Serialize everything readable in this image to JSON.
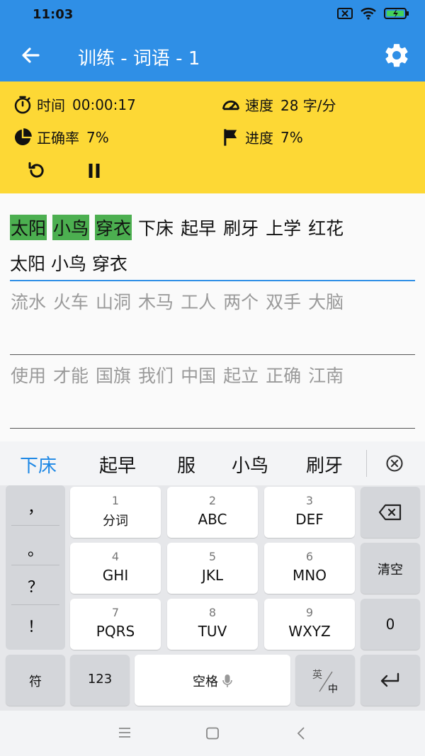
{
  "status": {
    "time": "11:03"
  },
  "appbar": {
    "title": "训练 - 词语 - 1"
  },
  "stats": {
    "time_label": "时间",
    "time_value": "00:00:17",
    "speed_label": "速度",
    "speed_value": "28 字/分",
    "accuracy_label": "正确率",
    "accuracy_value": "7%",
    "progress_label": "进度",
    "progress_value": "7%"
  },
  "practice": {
    "line1_words": [
      "太阳",
      "小鸟",
      "穿衣",
      "下床",
      "起早",
      "刷牙",
      "上学",
      "红花"
    ],
    "line1_done_count": 3,
    "typed_line": "太阳 小鸟 穿衣",
    "line2_words": [
      "流水",
      "火车",
      "山洞",
      "木马",
      "工人",
      "两个",
      "双手",
      "大脑"
    ],
    "line3_words": [
      "使用",
      "才能",
      "国旗",
      "我们",
      "中国",
      "起立",
      "正确",
      "江南"
    ]
  },
  "candidates": [
    "下床",
    "起早",
    "服",
    "小鸟",
    "刷牙"
  ],
  "keyboard": {
    "punct": [
      "，",
      "。",
      "？",
      "！"
    ],
    "keys": [
      {
        "num": "1",
        "label": "分词"
      },
      {
        "num": "2",
        "label": "ABC"
      },
      {
        "num": "3",
        "label": "DEF"
      },
      {
        "num": "4",
        "label": "GHI"
      },
      {
        "num": "5",
        "label": "JKL"
      },
      {
        "num": "6",
        "label": "MNO"
      },
      {
        "num": "7",
        "label": "PQRS"
      },
      {
        "num": "8",
        "label": "TUV"
      },
      {
        "num": "9",
        "label": "WXYZ"
      }
    ],
    "clear_label": "清空",
    "zero_label": "0",
    "symbol_label": "符",
    "num_label": "123",
    "space_label": "空格",
    "lang_en": "英",
    "lang_zh": "中"
  },
  "colors": {
    "primary": "#2f8fe6",
    "stats_bg": "#fdd835",
    "correct": "#4caf50"
  }
}
